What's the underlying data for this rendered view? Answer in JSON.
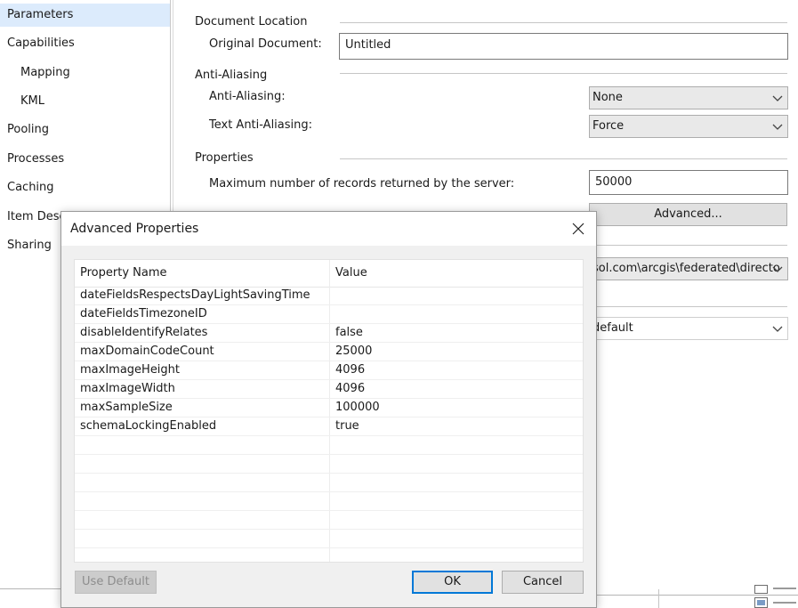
{
  "sidebar": {
    "items": [
      {
        "label": "Parameters",
        "selected": true
      },
      {
        "label": "Capabilities"
      },
      {
        "label": "Mapping",
        "sub": true
      },
      {
        "label": "KML",
        "sub": true
      },
      {
        "label": "Pooling"
      },
      {
        "label": "Processes"
      },
      {
        "label": "Caching"
      },
      {
        "label": "Item Desc"
      },
      {
        "label": "Sharing"
      }
    ]
  },
  "panel": {
    "document_location": {
      "title": "Document Location",
      "original_document_label": "Original Document:",
      "original_document_value": "Untitled"
    },
    "anti_aliasing": {
      "title": "Anti-Aliasing",
      "anti_aliasing_label": "Anti-Aliasing:",
      "anti_aliasing_value": "None",
      "text_anti_aliasing_label": "Text Anti-Aliasing:",
      "text_anti_aliasing_value": "Force"
    },
    "properties": {
      "title": "Properties",
      "max_records_label": "Maximum number of records returned by the server:",
      "max_records_value": "50000",
      "advanced_button": "Advanced..."
    },
    "hidden_combo_1_value": "sol.com\\arcgis\\federated\\directo",
    "hidden_combo_2_value": "default"
  },
  "dialog": {
    "title": "Advanced Properties",
    "columns": {
      "name": "Property Name",
      "value": "Value"
    },
    "rows": [
      {
        "name": "dateFieldsRespectsDayLightSavingTime",
        "value": ""
      },
      {
        "name": "dateFieldsTimezoneID",
        "value": ""
      },
      {
        "name": "disableIdentifyRelates",
        "value": "false"
      },
      {
        "name": "maxDomainCodeCount",
        "value": "25000"
      },
      {
        "name": "maxImageHeight",
        "value": "4096"
      },
      {
        "name": "maxImageWidth",
        "value": "4096"
      },
      {
        "name": "maxSampleSize",
        "value": "100000"
      },
      {
        "name": "schemaLockingEnabled",
        "value": "true"
      }
    ],
    "use_default_button": "Use Default",
    "ok_button": "OK",
    "cancel_button": "Cancel"
  },
  "colors": {
    "selection": "#dcebfc",
    "button_focus_border": "#0078d7",
    "disabled_text": "#8d8d8d"
  },
  "icons": {
    "dropdown": "chevron-down-icon",
    "close": "close-icon",
    "checkbox": "checkbox-icon"
  }
}
